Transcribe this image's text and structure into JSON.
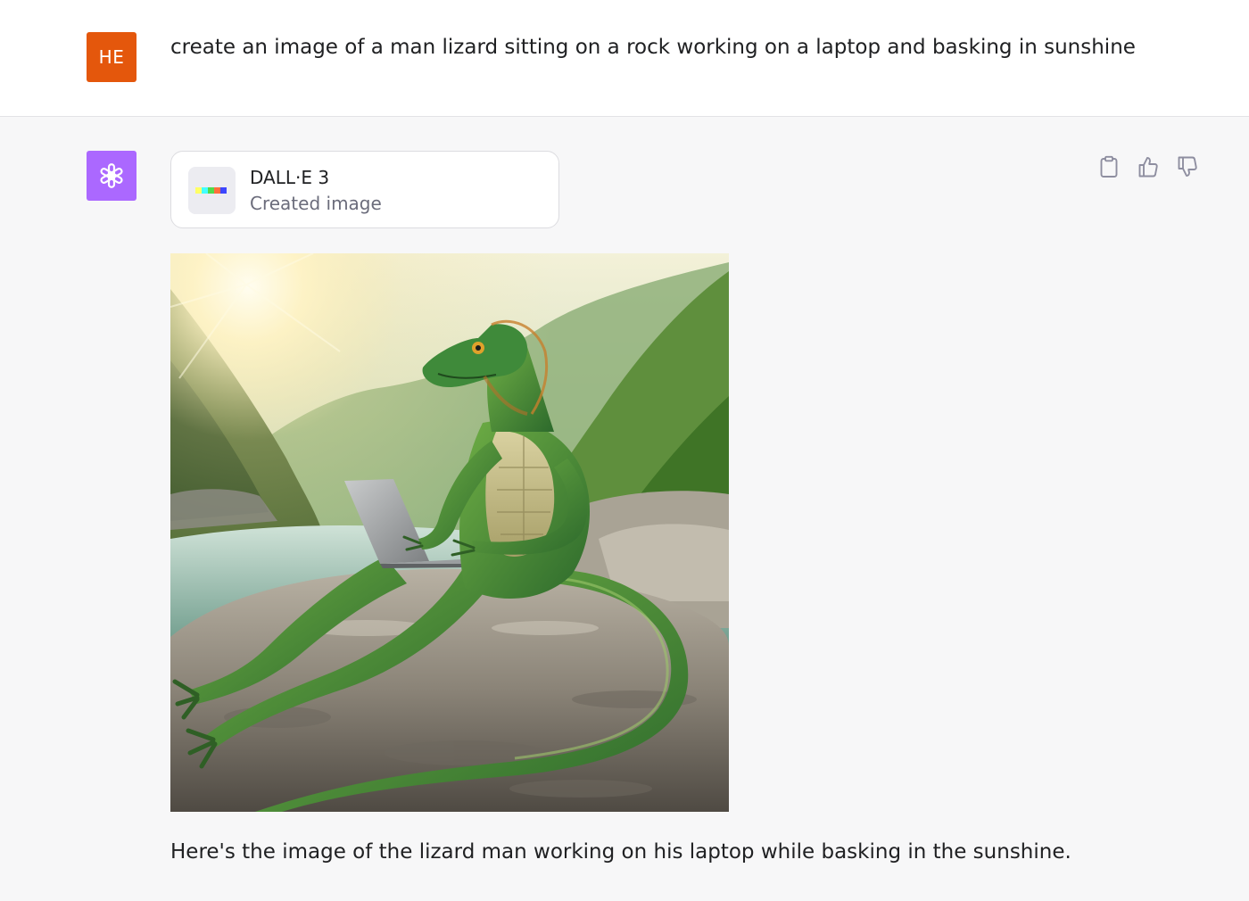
{
  "user_message": {
    "avatar_initials": "HE",
    "avatar_color": "#e4570c",
    "text": "create an image of a man lizard sitting on a rock working on a laptop and basking in sunshine"
  },
  "assistant_message": {
    "avatar_icon": "openai-logo-icon",
    "avatar_color": "#ab68ff",
    "tool": {
      "name": "DALL·E 3",
      "status": "Created image",
      "icon": "dalle-palette-icon",
      "palette_colors": [
        "#ffff66",
        "#42ffff",
        "#51da4c",
        "#ff6e3c",
        "#3c46ff"
      ]
    },
    "actions": [
      {
        "name": "copy",
        "icon": "clipboard-icon"
      },
      {
        "name": "thumbs-up",
        "icon": "thumbs-up-icon"
      },
      {
        "name": "thumbs-down",
        "icon": "thumbs-down-icon"
      }
    ],
    "image": {
      "icon": "generated-image"
    },
    "text": "Here's the image of the lizard man working on his laptop while basking in the sunshine."
  }
}
